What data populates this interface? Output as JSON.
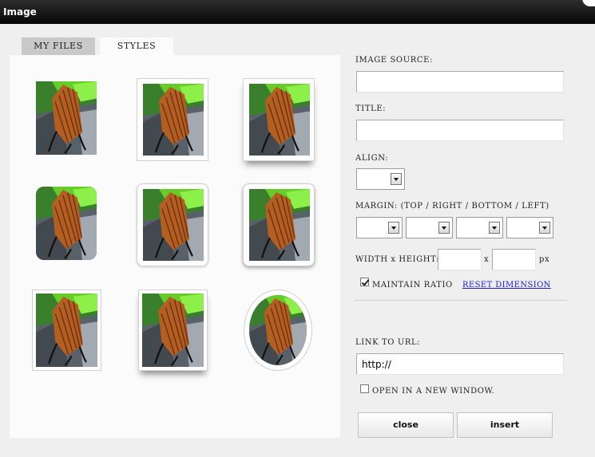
{
  "window": {
    "title": "Image"
  },
  "tabs": [
    {
      "label": "MY FILES",
      "active": false
    },
    {
      "label": "STYLES",
      "active": true
    }
  ],
  "styles_gallery": {
    "items": [
      "plain",
      "white-frame",
      "frame-bottom-shadow",
      "rounded-corners",
      "rounded-white-frame",
      "rounded-frame-shadow",
      "thin-border",
      "border-bottom-shadow",
      "oval-frame"
    ]
  },
  "form": {
    "image_source": {
      "label": "IMAGE SOURCE:",
      "value": ""
    },
    "title": {
      "label": "TITLE:",
      "value": ""
    },
    "align": {
      "label": "ALIGN:",
      "value": ""
    },
    "margin": {
      "label": "MARGIN: (TOP / RIGHT / BOTTOM / LEFT)",
      "values": [
        "",
        "",
        "",
        ""
      ]
    },
    "size": {
      "label": "WIDTH x HEIGHT:",
      "separator": "x",
      "unit": "px",
      "width": "",
      "height": ""
    },
    "maintain_ratio": {
      "label": "MAINTAIN RATIO",
      "checked": true
    },
    "reset_dimension": {
      "label": "RESET DIMENSION"
    },
    "link_url": {
      "label": "LINK TO URL:",
      "value": "http://"
    },
    "new_window": {
      "label": "OPEN IN A NEW WINDOW.",
      "checked": false
    }
  },
  "buttons": {
    "close": "close",
    "insert": "insert"
  },
  "colors": {
    "titlebar": "#0a0a0a",
    "link": "#1a1ad6",
    "panel": "#fbfbfb"
  }
}
